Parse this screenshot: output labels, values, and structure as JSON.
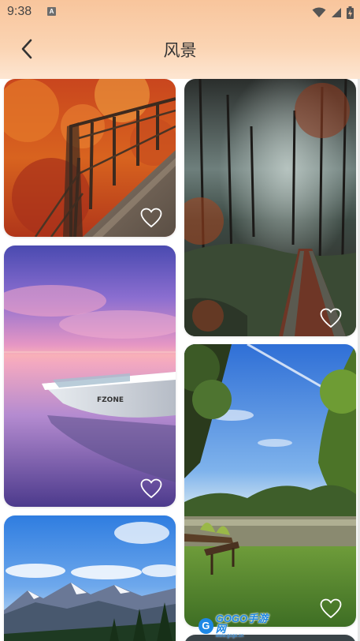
{
  "status_bar": {
    "time": "9:38",
    "notification_icon": "a-notification-icon",
    "icons": [
      "wifi-icon",
      "signal-icon",
      "battery-icon"
    ]
  },
  "nav": {
    "back_icon": "chevron-left-icon",
    "title": "风景"
  },
  "gallery": {
    "columns": 2,
    "items": [
      {
        "scene": "autumn-wooden-bridge",
        "favorite_icon": "heart-outline-icon",
        "favorited": false
      },
      {
        "scene": "misty-forest-stone-bridge",
        "favorite_icon": "heart-outline-icon",
        "favorited": false
      },
      {
        "scene": "sunset-boat-on-lake",
        "favorite_icon": "heart-outline-icon",
        "favorited": false
      },
      {
        "scene": "lakeside-meadow-bench",
        "favorite_icon": "heart-outline-icon",
        "favorited": false
      },
      {
        "scene": "snowy-mountains",
        "favorite_icon": "heart-outline-icon",
        "favorited": false
      }
    ]
  },
  "watermark": {
    "logo_letter": "G",
    "text": "GOGO手游网",
    "sub": "www.gogo.cn"
  },
  "colors": {
    "header_gradient_top": "#f8c59c",
    "header_gradient_bottom": "#fde6d2",
    "title_color": "#333333",
    "heart_color": "#ffffff",
    "watermark_color": "#1e88e5"
  }
}
